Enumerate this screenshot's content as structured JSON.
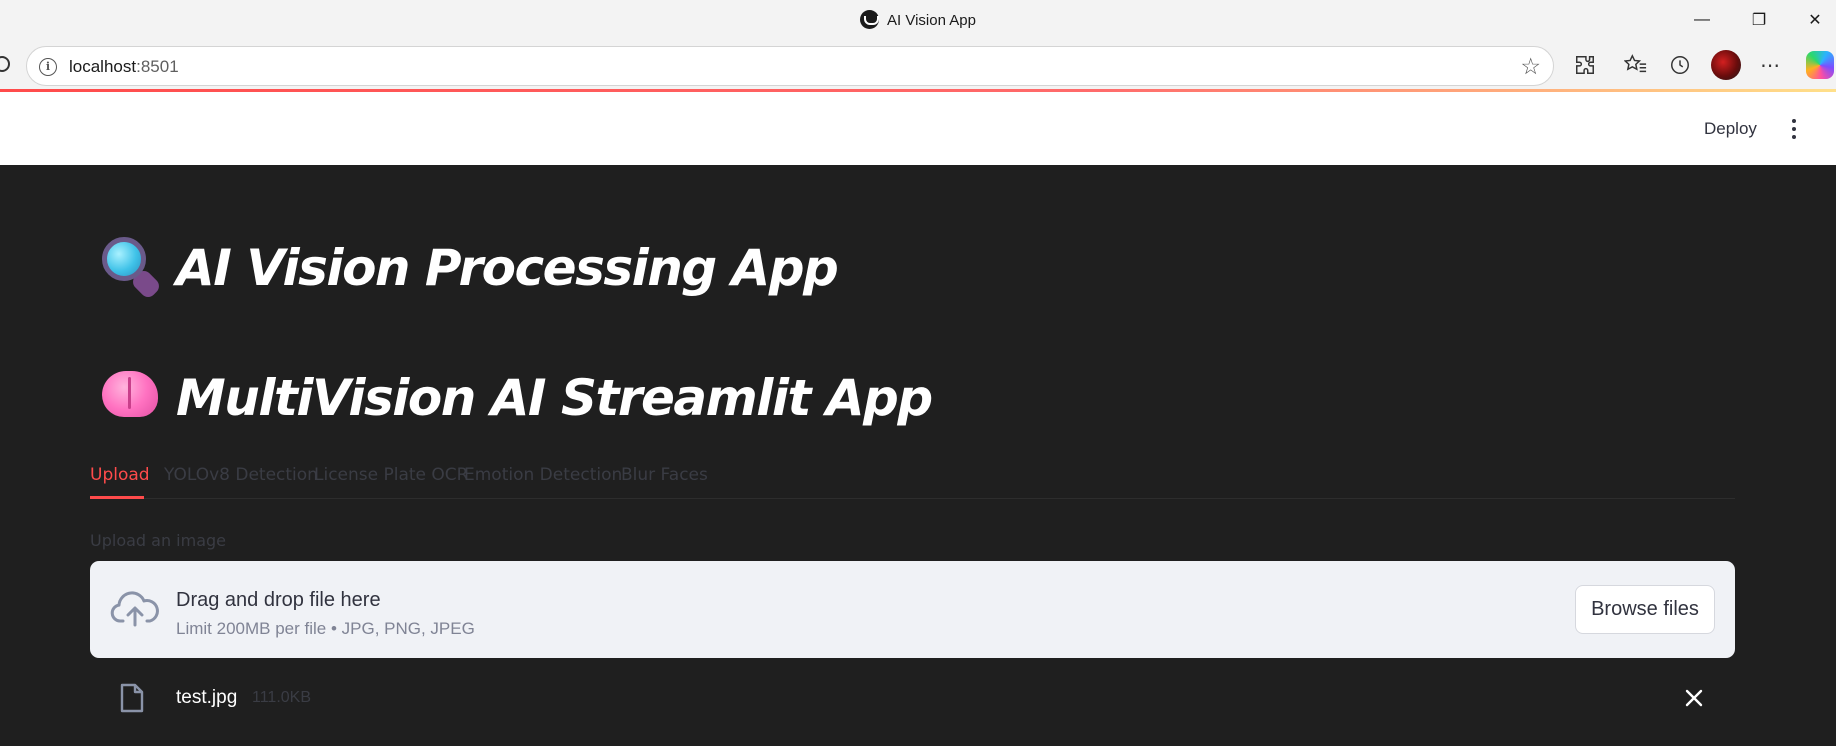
{
  "window": {
    "title": "AI Vision App",
    "minimize": "—",
    "restore": "❐",
    "close": "✕"
  },
  "browser": {
    "url_host": "localhost",
    "url_port": ":8501"
  },
  "header": {
    "deploy_label": "Deploy"
  },
  "main": {
    "title1": "AI Vision Processing App",
    "title2": "MultiVision AI Streamlit App",
    "tabs": [
      {
        "label": "Upload"
      },
      {
        "label": "YOLOv8 Detection"
      },
      {
        "label": "License Plate OCR"
      },
      {
        "label": "Emotion Detection"
      },
      {
        "label": "Blur Faces"
      }
    ],
    "upload_label": "Upload an image",
    "dropzone": {
      "title": "Drag and drop file here",
      "subtitle": "Limit 200MB per file • JPG, PNG, JPEG",
      "browse_label": "Browse files"
    },
    "file": {
      "name": "test.jpg",
      "size": "111.0KB"
    }
  },
  "colors": {
    "accent": "#ff4b4b",
    "background": "#1f1f1f",
    "dropzone": "#f0f2f6"
  }
}
